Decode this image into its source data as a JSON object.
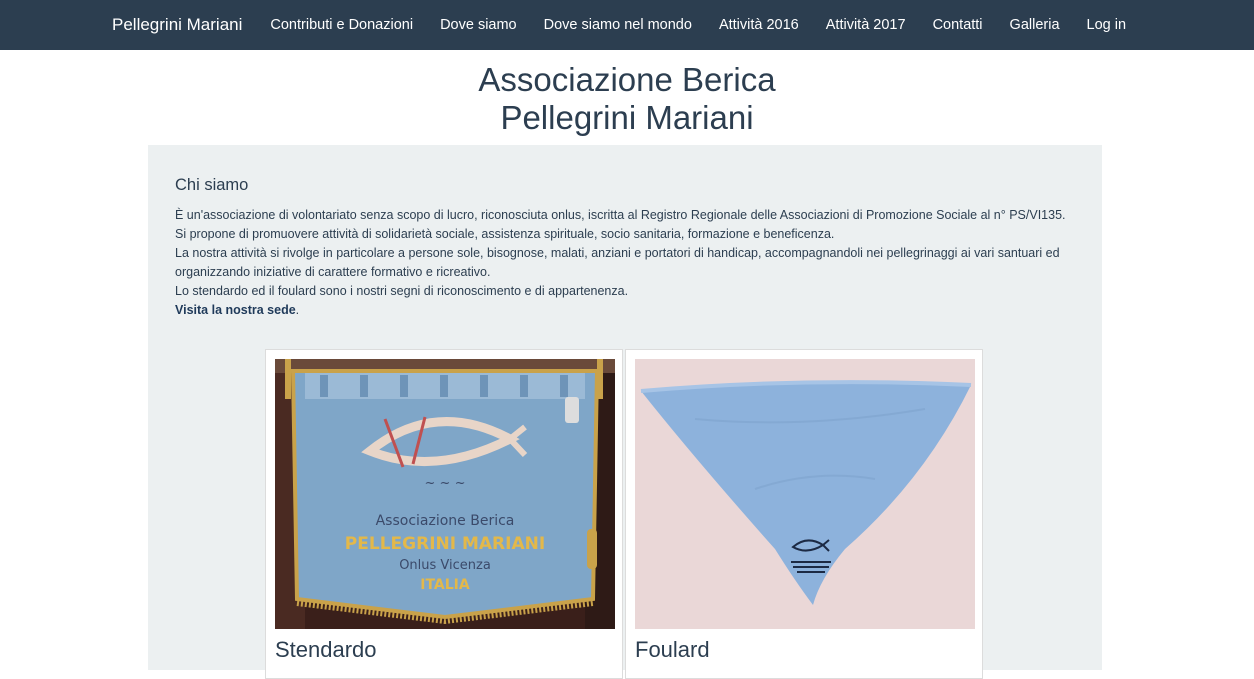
{
  "navbar": {
    "brand": "Pellegrini Mariani",
    "links": [
      "Contributi e Donazioni",
      "Dove siamo",
      "Dove siamo nel mondo",
      "Attività 2016",
      "Attività 2017",
      "Contatti",
      "Galleria",
      "Log in"
    ]
  },
  "header": {
    "line1": "Associazione Berica",
    "line2": "Pellegrini Mariani"
  },
  "about": {
    "title": "Chi siamo",
    "p1": "È un'associazione di volontariato senza scopo di lucro, riconosciuta onlus, iscritta al Registro Regionale delle Associazioni di Promozione Sociale al n° PS/VI135.",
    "p2": "Si propone di promuovere attività di solidarietà sociale, assistenza spirituale, socio sanitaria, formazione e beneficenza.",
    "p3": "La nostra attività si rivolge in particolare a persone sole, bisognose, malati, anziani e portatori di handicap, accompagnandoli nei pellegrinaggi ai vari santuari ed organizzando iniziative di carattere formativo e ricreativo.",
    "p4": "Lo stendardo ed il foulard sono i nostri segni di riconoscimento e di appartenenza.",
    "link_text": "Visita la nostra sede",
    "link_suffix": "."
  },
  "gallery": [
    {
      "caption": "Stendardo",
      "banner_text": [
        "Associazione Berica",
        "PELLEGRINI MARIANI",
        "Onlus Vicenza",
        "ITALIA"
      ]
    },
    {
      "caption": "Foulard"
    }
  ],
  "colors": {
    "navbar": "#2c3e50",
    "jumbotron": "#ecf0f1",
    "banner_blue": "#7fa6c8",
    "foulard_blue": "#8db2dc",
    "wall_pink": "#e7d3d2"
  }
}
